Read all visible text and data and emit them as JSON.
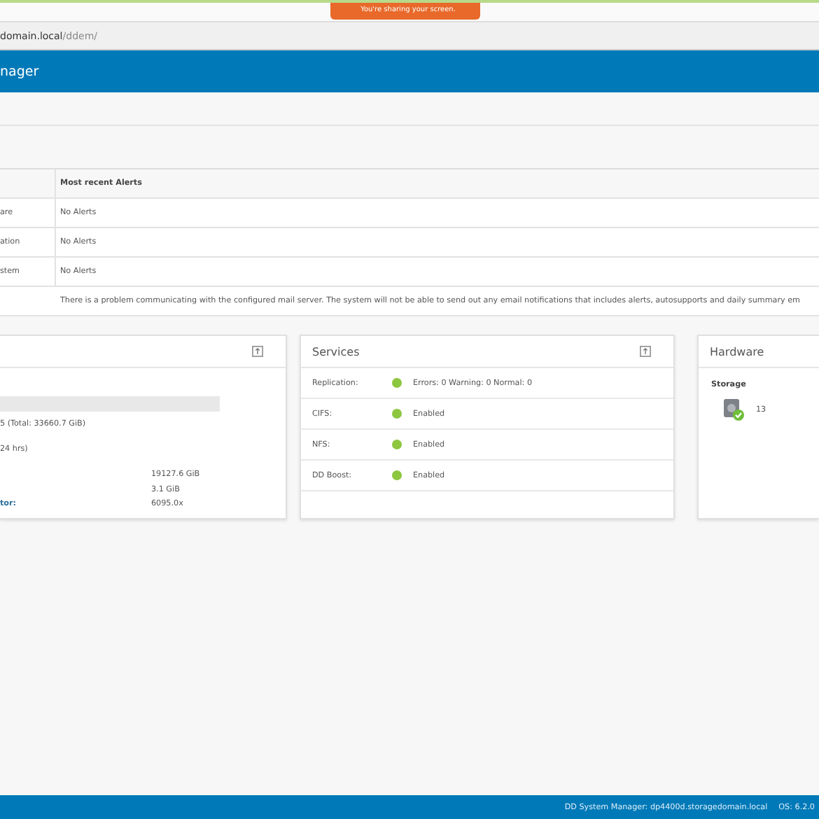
{
  "share_banner": {
    "text": "You're sharing your screen."
  },
  "address_bar": {
    "host": "domain.local",
    "path": "/ddem/"
  },
  "header": {
    "title": "nager"
  },
  "alerts_table": {
    "columns": [
      null,
      "Most recent Alerts"
    ],
    "rows": [
      [
        "are",
        "No Alerts"
      ],
      [
        "ation",
        "No Alerts"
      ],
      [
        "stem",
        "No Alerts"
      ],
      [
        null,
        "There is a problem communicating with the configured mail server. The system will not be able to send out any email notifications that includes alerts, autosupports and daily summary em"
      ]
    ]
  },
  "capacity_panel": {
    "lines": [
      "5 (Total: 33660.7 GiB)",
      "24 hrs)"
    ],
    "stats": [
      {
        "value": "19127.6 GiB"
      },
      {
        "value": "3.1 GiB"
      },
      {
        "label": "tor:",
        "value": "6095.0x"
      }
    ]
  },
  "services_panel": {
    "title": "Services",
    "rows": [
      {
        "label": "Replication:",
        "value": "Errors: 0 Warning: 0 Normal: 0",
        "color": "#8dc63f"
      },
      {
        "label": "CIFS:",
        "value": "Enabled",
        "color": "#8dc63f"
      },
      {
        "label": "NFS:",
        "value": "Enabled",
        "color": "#8dc63f"
      },
      {
        "label": "DD Boost:",
        "value": "Enabled",
        "color": "#8dc63f"
      }
    ]
  },
  "hardware_panel": {
    "title": "Hardware",
    "section": "Storage",
    "count": "13"
  },
  "status_bar": {
    "system": "DD System Manager: dp4400d.storagedomain.local",
    "os": "OS: 6.2.0"
  }
}
